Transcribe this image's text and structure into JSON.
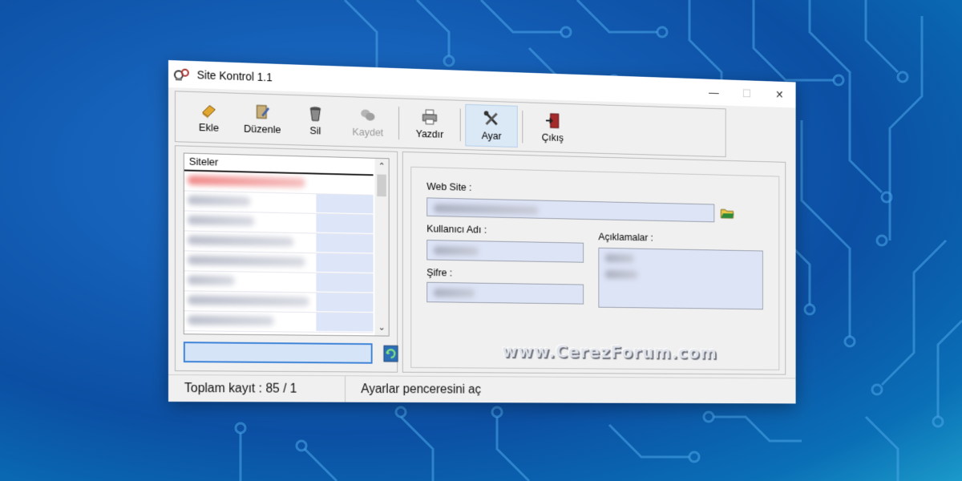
{
  "window": {
    "title": "Site Kontrol 1.1",
    "minimize": "—",
    "maximize": "☐",
    "close": "✕"
  },
  "toolbar": {
    "items": [
      {
        "label": "Ekle",
        "icon": "add-book-icon"
      },
      {
        "label": "Düzenle",
        "icon": "edit-icon"
      },
      {
        "label": "Sil",
        "icon": "trash-icon"
      },
      {
        "label": "Kaydet",
        "icon": "save-icon",
        "disabled": true
      },
      {
        "label": "Yazdır",
        "icon": "printer-icon"
      },
      {
        "label": "Ayar",
        "icon": "tools-icon",
        "active": true
      },
      {
        "label": "Çıkış",
        "icon": "exit-icon"
      }
    ]
  },
  "sites": {
    "header": "Siteler",
    "scroll_up": "⌃",
    "scroll_down": "⌄"
  },
  "form": {
    "web_site_label": "Web Site :",
    "username_label": "Kullanıcı Adı :",
    "password_label": "Şifre :",
    "notes_label": "Açıklamalar :"
  },
  "watermark": "www.CerezForum.com",
  "status": {
    "total": "Toplam kayıt : 85 / 1",
    "message": "Ayarlar penceresini aç"
  },
  "colors": {
    "field_bg": "#dde4f6",
    "active_tool": "#dbe8f5",
    "desktop_bg": "#1560b8"
  }
}
